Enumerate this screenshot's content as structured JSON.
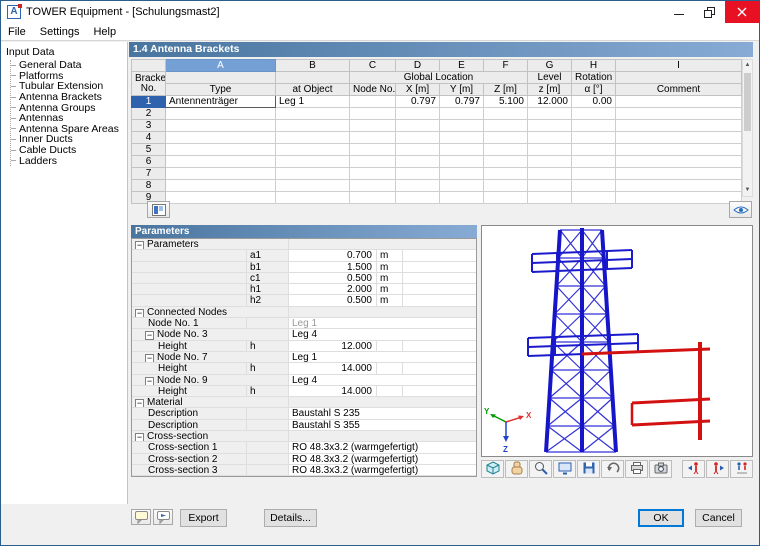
{
  "window": {
    "title": "TOWER Equipment - [Schulungsmast2]",
    "app_icon_letter": "A",
    "menu": [
      "File",
      "Settings",
      "Help"
    ]
  },
  "sidebar": {
    "root": "Input Data",
    "items": [
      "General Data",
      "Platforms",
      "Tubular Extension",
      "Antenna Brackets",
      "Antenna Groups",
      "Antennas",
      "Antenna Spare Areas",
      "Inner Ducts",
      "Cable Ducts",
      "Ladders"
    ]
  },
  "panel": {
    "title": "1.4 Antenna Brackets"
  },
  "table": {
    "corner": {
      "line1": "Bracket",
      "line2": "No."
    },
    "letters": [
      "A",
      "B",
      "C",
      "D",
      "E",
      "F",
      "G",
      "H",
      "I"
    ],
    "group_global": "Global Location",
    "group_level": "Level",
    "group_rotation": "Rotation",
    "subheaders": [
      "Type",
      "at Object",
      "Node No.",
      "X [m]",
      "Y [m]",
      "Z [m]",
      "z [m]",
      "α [°]",
      "Comment"
    ],
    "rows": [
      {
        "no": "1",
        "type": "Antennenträger",
        "at_object": "Leg 1",
        "node_no": "",
        "x": "0.797",
        "y": "0.797",
        "z": "5.100",
        "level_z": "12.000",
        "rotation": "0.00",
        "comment": ""
      },
      {
        "no": "2"
      },
      {
        "no": "3"
      },
      {
        "no": "4"
      },
      {
        "no": "5"
      },
      {
        "no": "6"
      },
      {
        "no": "7"
      },
      {
        "no": "8"
      },
      {
        "no": "9"
      }
    ]
  },
  "parameters": {
    "header": "Parameters",
    "rows": [
      {
        "kind": "group",
        "level": 0,
        "label": "Parameters"
      },
      {
        "kind": "item",
        "level": 1,
        "label": "",
        "sym": "a1",
        "value": "0.700",
        "unit": "m",
        "num": true
      },
      {
        "kind": "item",
        "level": 1,
        "label": "",
        "sym": "b1",
        "value": "1.500",
        "unit": "m",
        "num": true
      },
      {
        "kind": "item",
        "level": 1,
        "label": "",
        "sym": "c1",
        "value": "0.500",
        "unit": "m",
        "num": true
      },
      {
        "kind": "item",
        "level": 1,
        "label": "",
        "sym": "h1",
        "value": "2.000",
        "unit": "m",
        "num": true
      },
      {
        "kind": "item",
        "level": 1,
        "label": "",
        "sym": "h2",
        "value": "0.500",
        "unit": "m",
        "num": true
      },
      {
        "kind": "group",
        "level": 0,
        "label": "Connected Nodes"
      },
      {
        "kind": "item",
        "level": 1,
        "label": "Node No. 1",
        "value": "Leg 1",
        "muted": true
      },
      {
        "kind": "group2",
        "level": 1,
        "label": "Node No. 3",
        "value": "Leg 4"
      },
      {
        "kind": "item",
        "level": 2,
        "label": "Height",
        "sym": "h",
        "value": "12.000",
        "num": true
      },
      {
        "kind": "group2",
        "level": 1,
        "label": "Node No. 7",
        "value": "Leg 1"
      },
      {
        "kind": "item",
        "level": 2,
        "label": "Height",
        "sym": "h",
        "value": "14.000",
        "num": true
      },
      {
        "kind": "group2",
        "level": 1,
        "label": "Node No. 9",
        "value": "Leg 4"
      },
      {
        "kind": "item",
        "level": 2,
        "label": "Height",
        "sym": "h",
        "value": "14.000",
        "num": true
      },
      {
        "kind": "group",
        "level": 0,
        "label": "Material"
      },
      {
        "kind": "item",
        "level": 1,
        "label": "Description",
        "value": "Baustahl S 235"
      },
      {
        "kind": "item",
        "level": 1,
        "label": "Description",
        "value": "Baustahl S 355"
      },
      {
        "kind": "group",
        "level": 0,
        "label": "Cross-section"
      },
      {
        "kind": "item",
        "level": 1,
        "label": "Cross-section 1",
        "value": "RO 48.3x3.2 (warmgefertigt)"
      },
      {
        "kind": "item",
        "level": 1,
        "label": "Cross-section 2",
        "value": "RO 48.3x3.2 (warmgefertigt)"
      },
      {
        "kind": "item",
        "level": 1,
        "label": "Cross-section 3",
        "value": "RO 48.3x3.2 (warmgefertigt)"
      }
    ]
  },
  "viewer": {
    "axis": {
      "x": "X",
      "y": "Y",
      "z": "Z"
    },
    "toolbar_icons": [
      "isometric-view-icon",
      "pan-hand-icon",
      "zoom-icon",
      "monitor-icon",
      "save-view-icon",
      "undo-view-icon",
      "print-icon",
      "camera-icon",
      "figure-prev-icon",
      "figure-next-icon",
      "figure-all-icon"
    ]
  },
  "footer": {
    "export": "Export",
    "details": "Details...",
    "ok": "OK",
    "cancel": "Cancel"
  },
  "icons": {
    "scroll_up": "▲",
    "scroll_down": "▼",
    "collapse": "−"
  },
  "colors": {
    "header_blue_start": "#49759f",
    "header_blue_end": "#87abd4",
    "selection_blue": "#2e62ad",
    "tower_blue": "#1616c8",
    "bracket_red": "#d41111",
    "axis_x": "#e03030",
    "axis_y": "#009b00",
    "axis_z": "#2244cc"
  }
}
